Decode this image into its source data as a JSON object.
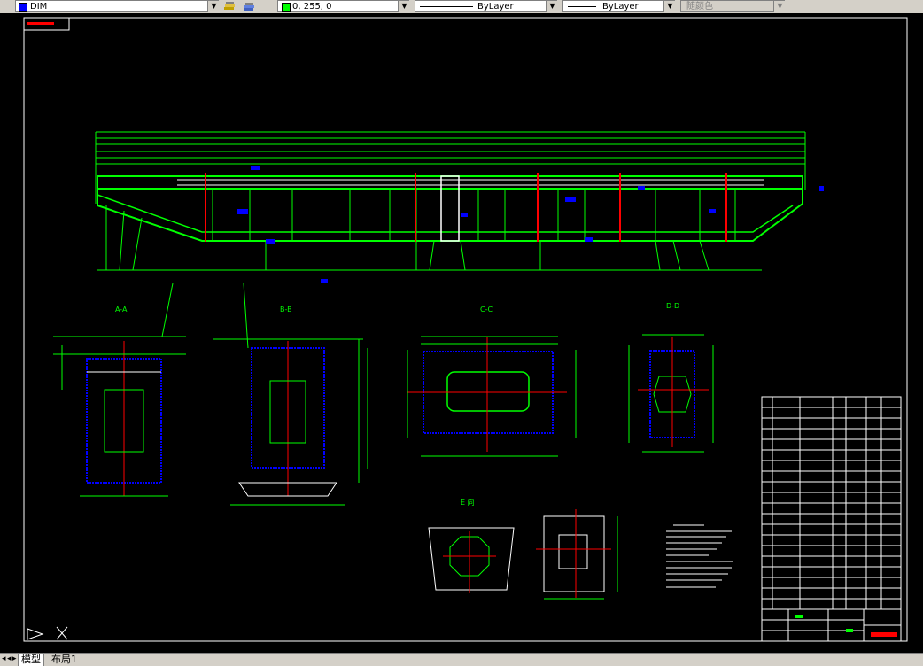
{
  "toolbar": {
    "layer_name": "DIM",
    "color_value": "0, 255, 0",
    "linetype_value": "ByLayer",
    "lineweight_value": "ByLayer",
    "plotstyle_value": "随颜色"
  },
  "sections": {
    "a": "A-A",
    "b": "B-B",
    "c": "C-C",
    "d": "D-D",
    "e": "E 向"
  },
  "tabs": {
    "model": "模型",
    "layout1": "布局1"
  },
  "colors": {
    "drawing_green": "#00ff00",
    "centerline_red": "#ff0000",
    "dimension_blue": "#0000ff",
    "line_white": "#ffffff",
    "background": "#000000"
  }
}
